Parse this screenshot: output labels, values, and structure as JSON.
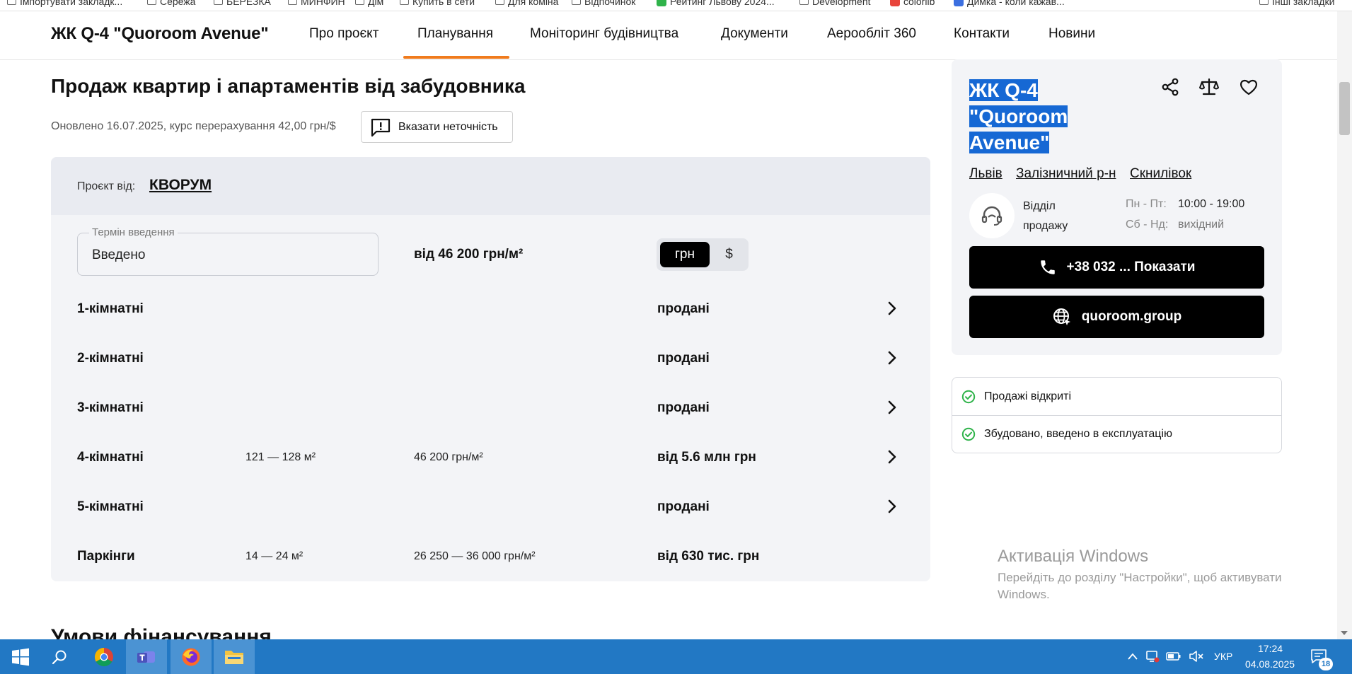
{
  "bookmarks": [
    "Імпортувати закладк...",
    "Сережа",
    "БЕРЕЗКА",
    "МИНФИН",
    "Дім",
    "Купить в сети",
    "Для коміна",
    "Відпочинок",
    "Рейтинг Львову 2024...",
    "Development",
    "colorlib",
    "Димка - коли кажав...",
    "Інші закладки"
  ],
  "header": {
    "logo": "ЖК Q-4 \"Quoroom Avenue\"",
    "nav": [
      "Про проєкт",
      "Планування",
      "Моніторинг будівництва",
      "Документи",
      "Аерообліт 360",
      "Контакти",
      "Новини"
    ],
    "active_nav": "Планування"
  },
  "main": {
    "title": "Продаж квартир і апартаментів від забудовника",
    "updated": "Оновлено 16.07.2025, курс перерахування 42,00 грн/$",
    "report_label": "Вказати неточність",
    "developer_label": "Проєкт від:",
    "developer_name": "КВОРУМ",
    "term_legend": "Термін введення",
    "term_value": "Введено",
    "price_from": "від 46 200 грн/м²",
    "currency": {
      "uah": "грн",
      "usd": "$",
      "selected": "грн"
    },
    "rows": [
      {
        "name": "1-кімнатні",
        "area": "",
        "price": "",
        "status": "продані"
      },
      {
        "name": "2-кімнатні",
        "area": "",
        "price": "",
        "status": "продані"
      },
      {
        "name": "3-кімнатні",
        "area": "",
        "price": "",
        "status": "продані"
      },
      {
        "name": "4-кімнатні",
        "area": "121 — 128 м²",
        "price": "46 200 грн/м²",
        "status": "від 5.6 млн грн"
      },
      {
        "name": "5-кімнатні",
        "area": "",
        "price": "",
        "status": "продані"
      },
      {
        "name": "Паркінги",
        "area": "14 — 24 м²",
        "price": "26 250 — 36 000 грн/м²",
        "status": "від 630 тис. грн"
      }
    ],
    "next_section": "Умови фінансування"
  },
  "sidebar": {
    "title_lines": [
      "ЖК Q-4",
      "\"Quoroom",
      "Avenue\""
    ],
    "locations": [
      "Львів",
      "Залізничний р-н",
      "Скнилівок"
    ],
    "dept_lines": [
      "Відділ",
      "продажу"
    ],
    "schedule": [
      {
        "days": "Пн - Пт:",
        "hours": "10:00 - 19:00"
      },
      {
        "days": "Сб - Нд:",
        "hours": "вихідний"
      }
    ],
    "phone_label": "+38 032 ... Показати",
    "site_label": "quoroom.group",
    "statuses": [
      "Продажі відкриті",
      "Збудовано, введено в експлуатацію"
    ]
  },
  "watermark": {
    "title": "Активація Windows",
    "text": "Перейдіть до розділу \"Настройки\", щоб активувати Windows."
  },
  "taskbar": {
    "lang": "УКР",
    "time": "17:24",
    "date": "04.08.2025",
    "notifications": "18"
  },
  "colors": {
    "accent": "#f07b1d",
    "selection": "#1668d4",
    "check": "#2fb34a",
    "taskbar": "#2278c4"
  }
}
